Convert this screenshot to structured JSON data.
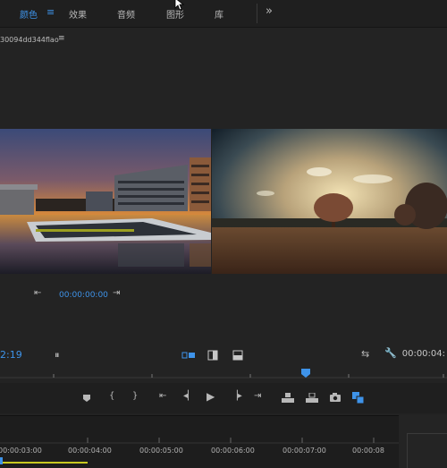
{
  "workspace_tabs": {
    "color": "颜色",
    "color_menu": "≡",
    "effects": "效果",
    "audio": "音频",
    "graphics": "图形",
    "library": "库",
    "more": "»"
  },
  "monitor": {
    "sequence_name": "30094dd344flao",
    "sequence_menu": "≡",
    "playhead_timecode": "00:00:00:00",
    "left_timecode": "2:19",
    "right_timecode": "00:00:04:"
  },
  "timeline": {
    "ruler_labels": [
      "00:00:03:00",
      "00:00:04:00",
      "00:00:05:00",
      "00:00:06:00",
      "00:00:07:00",
      "00:00:08"
    ]
  },
  "colors": {
    "accent": "#3e93e9",
    "panel": "#232323",
    "bar": "#1f1f1f"
  }
}
